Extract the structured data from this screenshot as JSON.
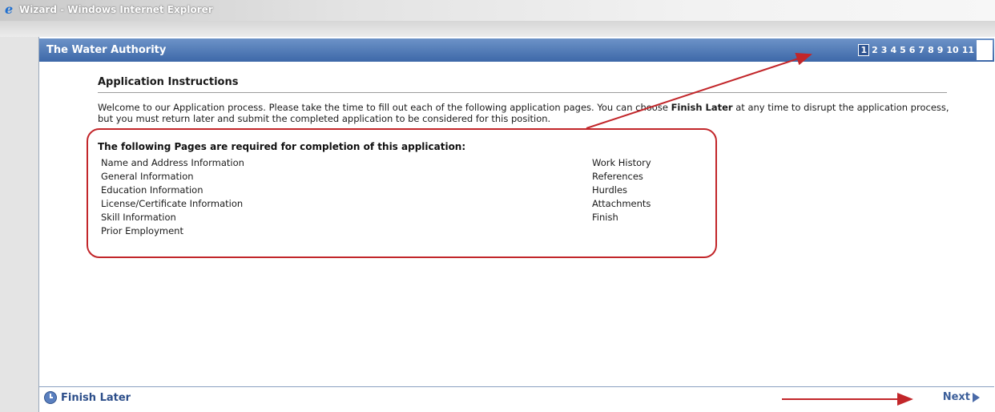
{
  "browser": {
    "title": "Wizard - Windows Internet Explorer",
    "icon": "ie-icon"
  },
  "wizard": {
    "org_name": "The Water Authority",
    "pages": [
      "1",
      "2",
      "3",
      "4",
      "5",
      "6",
      "7",
      "8",
      "9",
      "10",
      "11"
    ],
    "current_page": "1"
  },
  "instructions": {
    "title": "Application Instructions",
    "welcome_before": "Welcome to our Application process. Please take the time to fill out each of the following application pages. You can choose ",
    "welcome_bold": "Finish Later",
    "welcome_after": " at any time to disrupt the application process, but you must return later and submit the completed application to be considered for this position."
  },
  "required": {
    "title": "The following Pages are required for completion of this application:",
    "left": [
      "Name and Address Information",
      "General Information",
      "Education Information",
      "License/Certificate Information",
      "Skill Information",
      "Prior Employment"
    ],
    "right": [
      "Work History",
      "References",
      "Hurdles",
      "Attachments",
      "Finish"
    ]
  },
  "footer": {
    "finish_later": "Finish Later",
    "next": "Next"
  },
  "colors": {
    "header_blue": "#3d68a8",
    "annotation_red": "#c2262a",
    "link_blue": "#2c4e8a"
  }
}
